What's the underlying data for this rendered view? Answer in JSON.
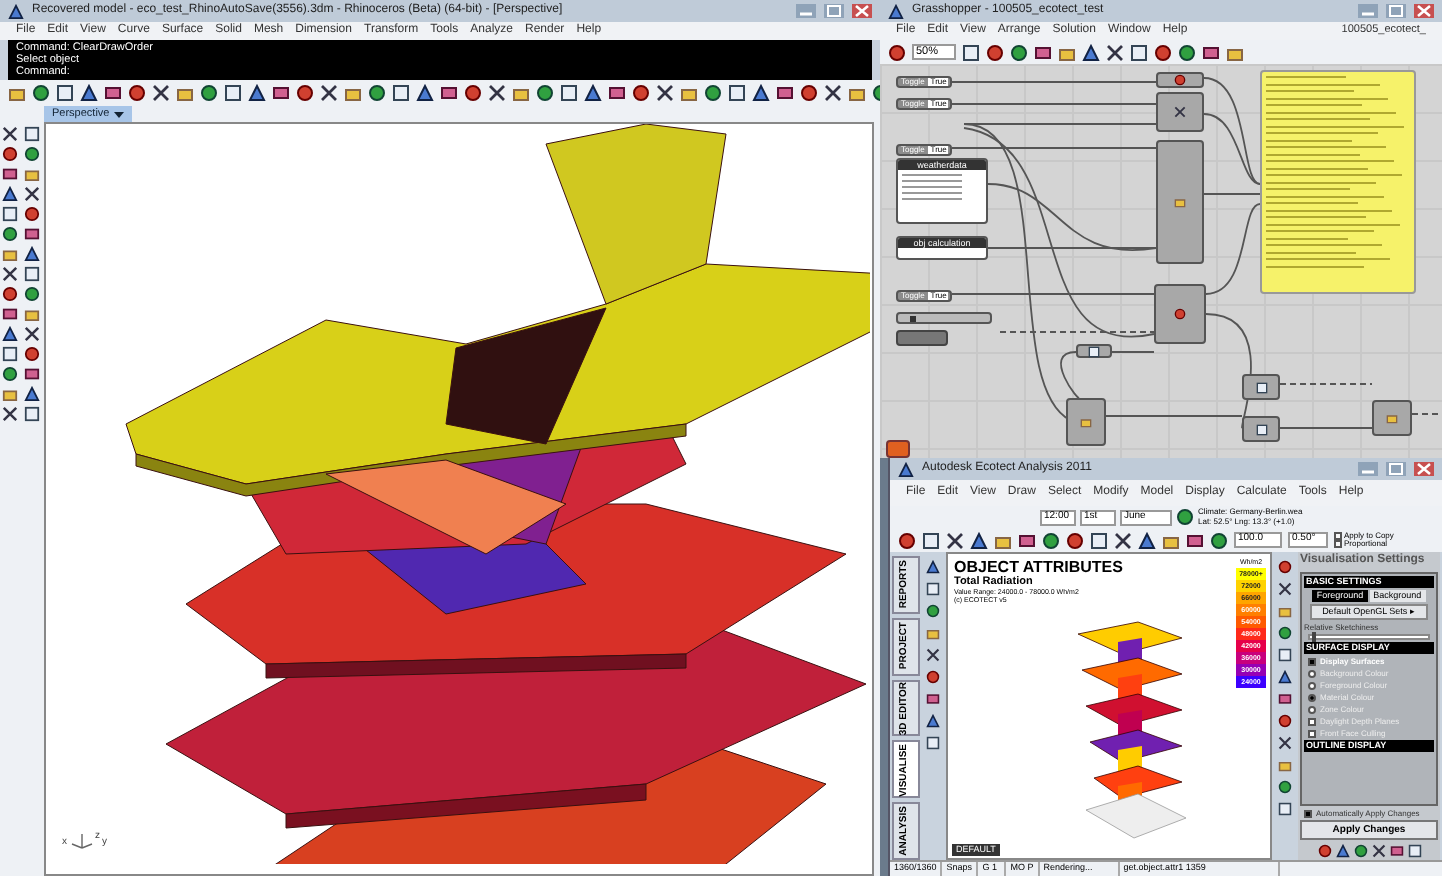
{
  "rhino": {
    "title": "Recovered model - eco_test_RhinoAutoSave(3556).3dm - Rhinoceros (Beta) (64-bit) - [Perspective]",
    "menu": [
      "File",
      "Edit",
      "View",
      "Curve",
      "Surface",
      "Solid",
      "Mesh",
      "Dimension",
      "Transform",
      "Tools",
      "Analyze",
      "Render",
      "Help"
    ],
    "command_lines": [
      "Command: ClearDrawOrder",
      "Select object",
      "Command:"
    ],
    "viewport_tab": "Perspective",
    "axis_labels": [
      "x",
      "z",
      "y"
    ]
  },
  "grasshopper": {
    "title": "Grasshopper - 100505_ecotect_test",
    "menu": [
      "File",
      "Edit",
      "View",
      "Arrange",
      "Solution",
      "Window",
      "Help"
    ],
    "document": "100505_ecotect_",
    "zoom": "50%",
    "toggles": [
      {
        "label": "Toggle",
        "value": "True"
      },
      {
        "label": "Toggle",
        "value": "True"
      },
      {
        "label": "Toggle",
        "value": "True"
      },
      {
        "label": "Toggle",
        "value": "True"
      }
    ],
    "panels": [
      {
        "title": "weatherdata"
      },
      {
        "title": "obj calculation"
      }
    ],
    "slider": {
      "level": 0.12
    }
  },
  "ecotect": {
    "title": "Autodesk Ecotect Analysis 2011",
    "menu": [
      "File",
      "Edit",
      "View",
      "Draw",
      "Select",
      "Modify",
      "Model",
      "Display",
      "Calculate",
      "Tools",
      "Help"
    ],
    "time": "12:00",
    "day": "1st",
    "month": "June",
    "climate": "Climate: Germany-Berlin.wea",
    "location": "Lat: 52.5°  Lng: 13.3° (+1.0)",
    "scale": "100.0",
    "angle": "0.50°",
    "apply_to_copy": {
      "label": "Apply to Copy",
      "checked": false
    },
    "proportional": {
      "label": "Proportional",
      "checked": false
    },
    "side_tabs": [
      {
        "label": "REPORTS",
        "selected": false
      },
      {
        "label": "PROJECT",
        "selected": false
      },
      {
        "label": "3D EDITOR",
        "selected": false
      },
      {
        "label": "VISUALISE",
        "selected": true
      },
      {
        "label": "ANALYSIS",
        "selected": false
      }
    ],
    "heading": "OBJECT ATTRIBUTES",
    "subheading": "Total Radiation",
    "value_range": "Value Range: 24000.0 - 78000.0 Wh/m2",
    "credit": "(c) ECOTECT v5",
    "legend_unit": "Wh/m2",
    "legend": [
      {
        "label": "78000+",
        "color": "#ffff00"
      },
      {
        "label": "72000",
        "color": "#ffd200"
      },
      {
        "label": "66000",
        "color": "#ffa500"
      },
      {
        "label": "60000",
        "color": "#ff7f00"
      },
      {
        "label": "54000",
        "color": "#ff5a00"
      },
      {
        "label": "48000",
        "color": "#ff2a1a"
      },
      {
        "label": "42000",
        "color": "#e6004b"
      },
      {
        "label": "36000",
        "color": "#c8007d"
      },
      {
        "label": "30000",
        "color": "#9600b4"
      },
      {
        "label": "24000",
        "color": "#3c00ff"
      }
    ],
    "view_tab": "DEFAULT",
    "settings_title": "Visualisation Settings",
    "settings": [
      {
        "kind": "header",
        "label": "BASIC SETTINGS"
      },
      {
        "kind": "pair",
        "labels": [
          "Foreground",
          "Background"
        ]
      },
      {
        "kind": "button",
        "label": "Default OpenGL Sets ▸"
      },
      {
        "kind": "slider",
        "label": "Relative Sketchiness",
        "level": 0.02
      },
      {
        "kind": "header",
        "label": "SURFACE DISPLAY"
      },
      {
        "kind": "checkbox",
        "label": "Display Surfaces",
        "checked": true
      },
      {
        "kind": "radio",
        "label": "Background Colour",
        "selected": false
      },
      {
        "kind": "radio",
        "label": "Foreground Colour",
        "selected": false
      },
      {
        "kind": "radio",
        "label": "Material Colour",
        "selected": true
      },
      {
        "kind": "radio",
        "label": "Zone Colour",
        "selected": false
      },
      {
        "kind": "checkbox",
        "label": "Daylight Depth Planes",
        "checked": false
      },
      {
        "kind": "checkbox",
        "label": "Front Face Culling",
        "checked": false
      },
      {
        "kind": "header",
        "label": "OUTLINE DISPLAY"
      }
    ],
    "auto_apply": {
      "label": "Automatically Apply Changes",
      "checked": true
    },
    "apply_button": "Apply Changes",
    "status": [
      "1360/1360",
      "Snaps",
      "G 1",
      "MO P",
      "Rendering...",
      "get.object.attr1 1359"
    ]
  }
}
